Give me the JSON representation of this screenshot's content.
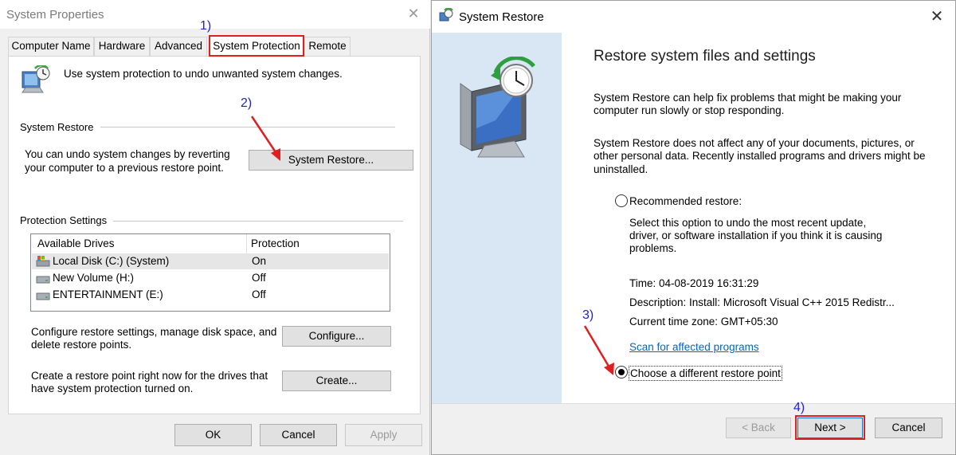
{
  "system_properties": {
    "title": "System Properties",
    "tabs": [
      "Computer Name",
      "Hardware",
      "Advanced",
      "System Protection",
      "Remote"
    ],
    "active_tab": "System Protection",
    "intro_text": "Use system protection to undo unwanted system changes.",
    "system_restore": {
      "group_label": "System Restore",
      "description_line1": "You can undo system changes by reverting",
      "description_line2": "your computer to a previous restore point.",
      "button_label": "System Restore..."
    },
    "protection_settings": {
      "group_label": "Protection Settings",
      "columns": [
        "Available Drives",
        "Protection"
      ],
      "drives": [
        {
          "name": "Local Disk (C:) (System)",
          "protection": "On",
          "icon": "system-drive-icon"
        },
        {
          "name": "New Volume (H:)",
          "protection": "Off",
          "icon": "drive-icon"
        },
        {
          "name": "ENTERTAINMENT (E:)",
          "protection": "Off",
          "icon": "drive-icon"
        }
      ],
      "configure_text_line1": "Configure restore settings, manage disk space, and",
      "configure_text_line2": "delete restore points.",
      "configure_button": "Configure...",
      "create_text_line1": "Create a restore point right now for the drives that",
      "create_text_line2": "have system protection turned on.",
      "create_button": "Create..."
    },
    "buttons": {
      "ok": "OK",
      "cancel": "Cancel",
      "apply": "Apply"
    }
  },
  "system_restore_wizard": {
    "title": "System Restore",
    "heading": "Restore system files and settings",
    "para1_line1": "System Restore can help fix problems that might be making your",
    "para1_line2": "computer run slowly or stop responding.",
    "para2_line1": "System Restore does not affect any of your documents, pictures, or",
    "para2_line2": "other personal data. Recently installed programs and drivers might be",
    "para2_line3": "uninstalled.",
    "recommended_label": "Recommended restore:",
    "recommended_desc_line1": "Select this option to undo the most recent update,",
    "recommended_desc_line2": "driver, or software installation if you think it is causing",
    "recommended_desc_line3": "problems.",
    "time": "Time: 04-08-2019 16:31:29",
    "description": "Description: Install: Microsoft Visual C++ 2015 Redistr...",
    "timezone": "Current time zone: GMT+05:30",
    "scan_link": "Scan for affected programs",
    "different_point_label": "Choose a different restore point",
    "selected_option": "different",
    "buttons": {
      "back": "< Back",
      "next": "Next >",
      "cancel": "Cancel"
    }
  },
  "annotations": {
    "step1": "1)",
    "step2": "2)",
    "step3": "3)",
    "step4": "4)",
    "color": "#2222cc",
    "highlight_color": "#e02020"
  }
}
